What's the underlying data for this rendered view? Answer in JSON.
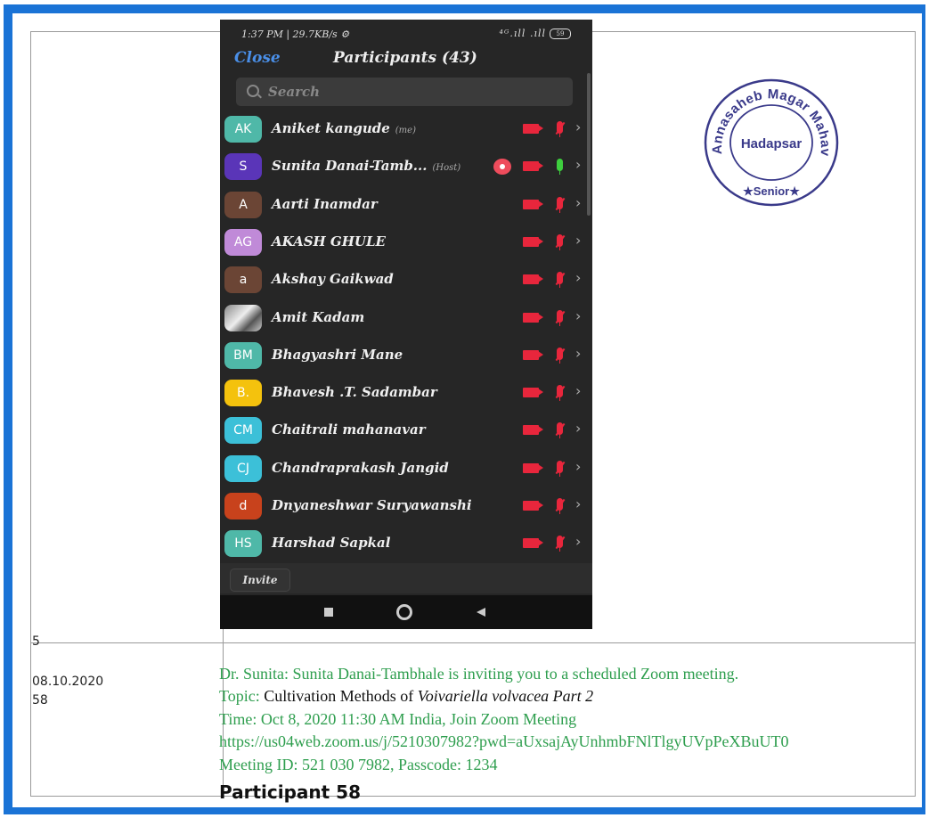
{
  "phone": {
    "status_time": "1:37 PM | 29.7KB/s ⚙",
    "status_signal": "⁴ᴳ.ıll .ıll",
    "battery": "59",
    "close_label": "Close",
    "title": "Participants (43)",
    "search_placeholder": "Search",
    "invite_label": "Invite",
    "participants": [
      {
        "initials": "AK",
        "name": "Aniket kangude",
        "tag": "(me)",
        "avatar_color": "#4fb8a8",
        "mic": "muted",
        "rec": false
      },
      {
        "initials": "S",
        "name": "Sunita Danai-Tamb...",
        "tag": "(Host)",
        "avatar_color": "#5a35b8",
        "mic": "on",
        "rec": true
      },
      {
        "initials": "A",
        "name": "Aarti Inamdar",
        "tag": "",
        "avatar_color": "#6b4535",
        "mic": "muted",
        "rec": false
      },
      {
        "initials": "AG",
        "name": "AKASH GHULE",
        "tag": "",
        "avatar_color": "#c08ad8",
        "mic": "muted",
        "rec": false
      },
      {
        "initials": "a",
        "name": "Akshay Gaikwad",
        "tag": "",
        "avatar_color": "#6b4535",
        "mic": "muted",
        "rec": false
      },
      {
        "initials": "",
        "name": "Amit Kadam",
        "tag": "",
        "avatar_color": "photo",
        "mic": "muted",
        "rec": false
      },
      {
        "initials": "BM",
        "name": "Bhagyashri Mane",
        "tag": "",
        "avatar_color": "#4fb8a8",
        "mic": "muted",
        "rec": false
      },
      {
        "initials": "B.",
        "name": "Bhavesh .T. Sadambar",
        "tag": "",
        "avatar_color": "#f4c20d",
        "mic": "muted",
        "rec": false
      },
      {
        "initials": "CM",
        "name": "Chaitrali mahanavar",
        "tag": "",
        "avatar_color": "#3cc0d8",
        "mic": "muted",
        "rec": false
      },
      {
        "initials": "CJ",
        "name": "Chandraprakash Jangid",
        "tag": "",
        "avatar_color": "#3cc0d8",
        "mic": "muted",
        "rec": false
      },
      {
        "initials": "d",
        "name": "Dnyaneshwar Suryawanshi",
        "tag": "",
        "avatar_color": "#c8421c",
        "mic": "muted",
        "rec": false
      },
      {
        "initials": "HS",
        "name": "Harshad Sapkal",
        "tag": "",
        "avatar_color": "#4fb8a8",
        "mic": "muted",
        "rec": false
      }
    ]
  },
  "stamp": {
    "outer_text": "Annasaheb Magar Mahavidyalaya",
    "center_text": "Hadapsar",
    "bottom_text": "Senior",
    "color": "#3a3a8a"
  },
  "row2": {
    "serial": "5",
    "date": "08.10.2020",
    "count": "58",
    "invite_line": "Dr. Sunita: Sunita Danai-Tambhale is inviting you to a scheduled Zoom meeting.",
    "topic_label": "Topic: ",
    "topic_text": "Cultivation Methods of ",
    "topic_italic": "Voivariella volvacea Part 2",
    "time_line": "Time: Oct 8, 2020 11:30 AM India, Join Zoom Meeting",
    "link": "https://us04web.zoom.us/j/5210307982?pwd=aUxsajAyUnhmbFNlTlgyUVpPeXBuUT0",
    "meeting_line": "Meeting ID: 521 030 7982, Passcode: 1234",
    "participant_label": "Participant 58"
  },
  "colors": {
    "border_blue": "#1a73d6",
    "text_green": "#2e9e4e",
    "zoom_blue": "#4a8fe8",
    "mute_red": "#e8263c"
  }
}
